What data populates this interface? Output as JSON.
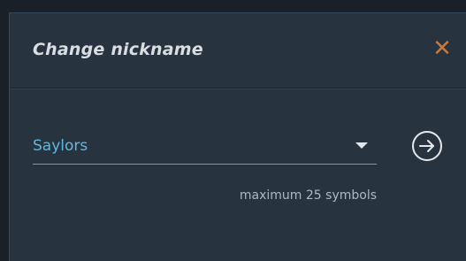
{
  "dialog": {
    "title": "Change nickname",
    "close_icon": "close-icon"
  },
  "nickname": {
    "selected_value": "Saylors",
    "dropdown_icon": "caret-down-icon",
    "hint": "maximum 25 symbols"
  },
  "submit": {
    "icon": "arrow-right-circle-icon"
  },
  "colors": {
    "panel": "#27343f",
    "title": "#d9dee3",
    "accent_close": "#c9773a",
    "value": "#5fb8e0",
    "hint": "#aeb7be"
  }
}
